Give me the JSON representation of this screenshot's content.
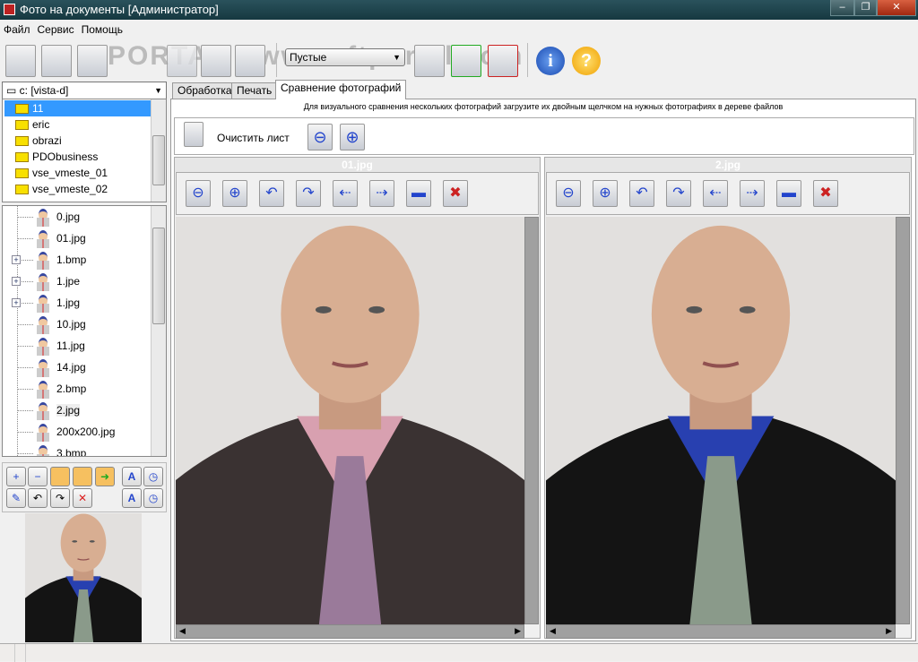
{
  "window": {
    "title": "Фото на документы  [Администратор]",
    "minimize": "–",
    "maximize": "❐",
    "close": "✕"
  },
  "menu": [
    "Файл",
    "Сервис",
    "Помощь"
  ],
  "toolbar": {
    "filter_select": "Пустые",
    "watermark": "PORTAL www.softportal.com"
  },
  "left": {
    "drive": "c: [vista-d]",
    "folders": [
      "11",
      "eric",
      "obrazi",
      "PDObusiness",
      "vse_vmeste_01",
      "vse_vmeste_02"
    ],
    "files": [
      "0.jpg",
      "01.jpg",
      "1.bmp",
      "1.jpe",
      "1.jpg",
      "10.jpg",
      "11.jpg",
      "14.jpg",
      "2.bmp",
      "2.jpg",
      "200x200.jpg",
      "3.bmp"
    ],
    "expandable": [
      false,
      false,
      true,
      true,
      true,
      false,
      false,
      false,
      false,
      false,
      false,
      false
    ]
  },
  "tabs": [
    "Обработка",
    "Печать",
    "Сравнение фотографий"
  ],
  "compare": {
    "hint": "Для визуального сравнения нескольких фотографий загрузите их двойным щелчком на нужных фотографиях в дереве файлов",
    "clear_label": "Очистить лист",
    "panes": [
      {
        "file": "01.jpg",
        "shirt": "#d8a0b0",
        "suit": "#3a3232"
      },
      {
        "file": "2.jpg",
        "shirt": "#2840b0",
        "suit": "#141414"
      }
    ]
  }
}
